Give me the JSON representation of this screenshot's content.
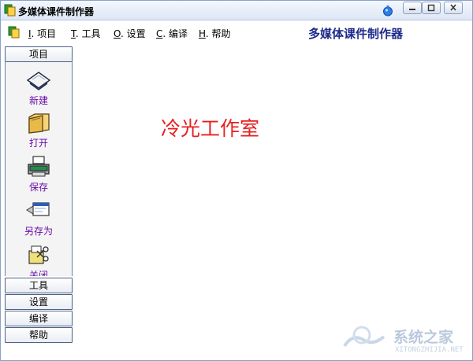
{
  "window": {
    "title": "多媒体课件制作器",
    "controls": {
      "minimize": "minimize",
      "maximize": "maximize",
      "close": "close"
    }
  },
  "menu": {
    "items": [
      {
        "key": "I",
        "label": ". 项目"
      },
      {
        "key": "T",
        "label": ". 工具"
      },
      {
        "key": "O",
        "label": ". 设置"
      },
      {
        "key": "C",
        "label": ". 编译"
      },
      {
        "key": "H",
        "label": ". 帮助"
      }
    ],
    "app_title": "多媒体课件制作器"
  },
  "sidebar": {
    "groups": [
      "项目",
      "工具",
      "设置",
      "编译",
      "帮助"
    ],
    "tools": [
      {
        "label": "新建",
        "icon": "new-document-icon"
      },
      {
        "label": "打开",
        "icon": "open-folder-icon"
      },
      {
        "label": "保存",
        "icon": "save-printer-icon"
      },
      {
        "label": "另存为",
        "icon": "save-as-window-icon"
      },
      {
        "label": "关闭",
        "icon": "close-tools-icon"
      }
    ],
    "scroll_icon": "down-arrow-icon"
  },
  "workspace": {
    "text": "冷光工作室"
  },
  "watermark": {
    "text": "系统之家",
    "url": "XITONGZHIJIA.NET"
  },
  "colors": {
    "app_title": "#1d2a8a",
    "workspace_text": "#e81e1e",
    "tool_label": "#6a0ea8"
  }
}
